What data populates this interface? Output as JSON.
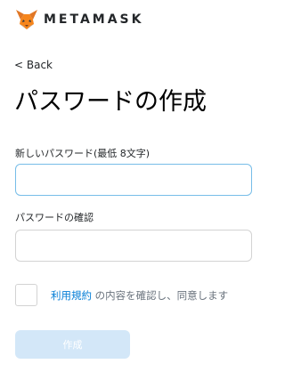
{
  "header": {
    "brand": "METAMASK",
    "logo_icon": "metamask-fox-icon"
  },
  "nav": {
    "back_label": "< Back"
  },
  "page": {
    "title": "パスワードの作成"
  },
  "form": {
    "new_password_label": "新しいパスワード(最低 8文字)",
    "new_password_value": "",
    "confirm_password_label": "パスワードの確認",
    "confirm_password_value": "",
    "terms_link": "利用規約",
    "terms_text": " の内容を確認し、同意します",
    "terms_checked": false,
    "create_label": "作成"
  },
  "colors": {
    "accent": "#037dd6",
    "button_disabled": "#d3e7f8",
    "focus_border": "#77bde8"
  }
}
